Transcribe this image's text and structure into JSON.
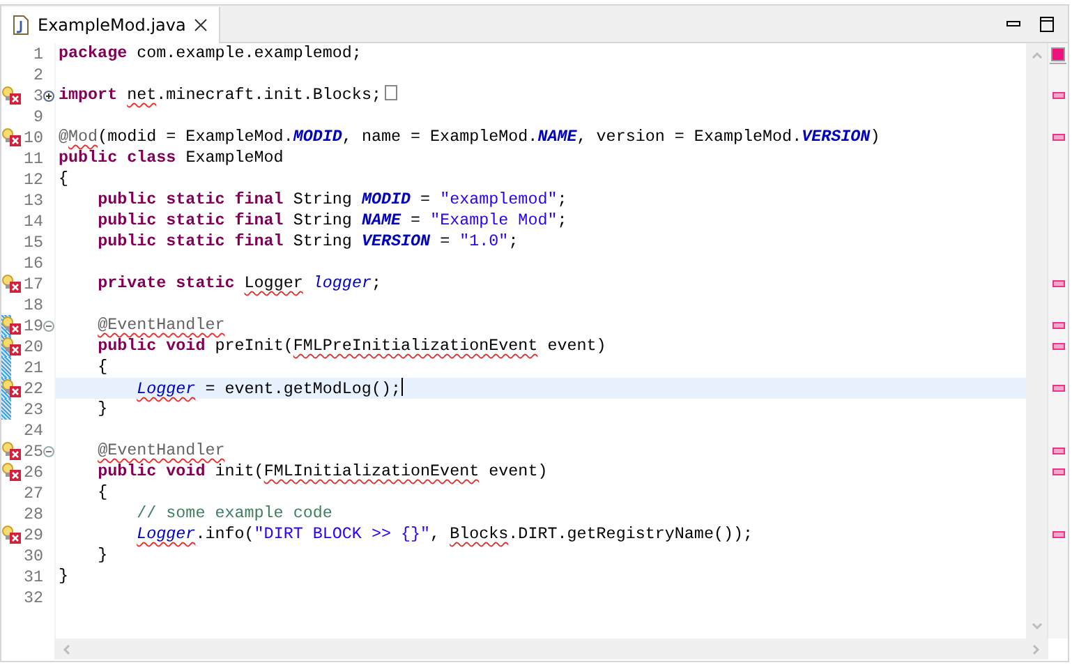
{
  "tab": {
    "title": "ExampleMod.java",
    "selected": true
  },
  "lines": [
    {
      "number": "1",
      "error": false,
      "tokens": [
        {
          "kind": "kw",
          "text": "package"
        },
        {
          "kind": "plain",
          "text": " com.example.examplemod;"
        }
      ]
    },
    {
      "number": "2",
      "error": false
    },
    {
      "number": "3",
      "error": true,
      "collapsed": true,
      "tokens": [
        {
          "kind": "kw",
          "text": "import "
        },
        {
          "kind": "plain",
          "text": "net",
          "error": true
        },
        {
          "kind": "plain",
          "text": ".minecraft.init.Blocks;"
        }
      ]
    },
    {
      "number": "9",
      "error": false
    },
    {
      "number": "10",
      "error": true,
      "tokens": [
        {
          "kind": "annotation",
          "text": "@"
        },
        {
          "kind": "annotation",
          "text": "Mod",
          "error": true
        },
        {
          "kind": "plain",
          "text": "(modid = ExampleMod."
        },
        {
          "kind": "constant",
          "text": "MODID"
        },
        {
          "kind": "plain",
          "text": ", name = ExampleMod."
        },
        {
          "kind": "constant",
          "text": "NAME"
        },
        {
          "kind": "plain",
          "text": ", version = ExampleMod."
        },
        {
          "kind": "constant",
          "text": "VERSION"
        },
        {
          "kind": "plain",
          "text": ")"
        }
      ]
    },
    {
      "number": "11",
      "error": false,
      "tokens": [
        {
          "kind": "kw",
          "text": "public class"
        },
        {
          "kind": "plain",
          "text": " ExampleMod"
        }
      ]
    },
    {
      "number": "12",
      "error": false,
      "tokens": [
        {
          "kind": "plain",
          "text": "{"
        }
      ]
    },
    {
      "number": "13",
      "error": false,
      "tokens": [
        {
          "kind": "kw",
          "text": "    public static final"
        },
        {
          "kind": "plain",
          "text": " String "
        },
        {
          "kind": "constant",
          "text": "MODID"
        },
        {
          "kind": "plain",
          "text": " = "
        },
        {
          "kind": "str",
          "text": "\"examplemod\""
        },
        {
          "kind": "plain",
          "text": ";"
        }
      ]
    },
    {
      "number": "14",
      "error": false,
      "tokens": [
        {
          "kind": "kw",
          "text": "    public static final"
        },
        {
          "kind": "plain",
          "text": " String "
        },
        {
          "kind": "constant",
          "text": "NAME"
        },
        {
          "kind": "plain",
          "text": " = "
        },
        {
          "kind": "str",
          "text": "\"Example Mod\""
        },
        {
          "kind": "plain",
          "text": ";"
        }
      ]
    },
    {
      "number": "15",
      "error": false,
      "tokens": [
        {
          "kind": "kw",
          "text": "    public static final"
        },
        {
          "kind": "plain",
          "text": " String "
        },
        {
          "kind": "constant",
          "text": "VERSION"
        },
        {
          "kind": "plain",
          "text": " = "
        },
        {
          "kind": "str",
          "text": "\"1.0\""
        },
        {
          "kind": "plain",
          "text": ";"
        }
      ]
    },
    {
      "number": "16",
      "error": false
    },
    {
      "number": "17",
      "error": true,
      "tokens": [
        {
          "kind": "kw",
          "text": "    private static "
        },
        {
          "kind": "plain",
          "text": "Logger",
          "error": true
        },
        {
          "kind": "field",
          "text": " logger"
        },
        {
          "kind": "plain",
          "text": ";"
        }
      ]
    },
    {
      "number": "18",
      "error": false
    },
    {
      "number": "19",
      "error": true,
      "changed": true,
      "collapsed": false,
      "tokens": [
        {
          "kind": "annotation",
          "text": "    @EventHandler",
          "error": true
        }
      ]
    },
    {
      "number": "20",
      "error": true,
      "changed": true,
      "tokens": [
        {
          "kind": "kw",
          "text": "    public void"
        },
        {
          "kind": "plain",
          "text": " preInit("
        },
        {
          "kind": "plain",
          "text": "FMLPreInitializationEvent",
          "error": true
        },
        {
          "kind": "plain",
          "text": " event)"
        }
      ]
    },
    {
      "number": "21",
      "error": false,
      "changed": true,
      "tokens": [
        {
          "kind": "plain",
          "text": "    {"
        }
      ]
    },
    {
      "number": "22",
      "error": true,
      "changed": true,
      "current": true,
      "tokens": [
        {
          "kind": "field",
          "text": "        Logger",
          "error": true
        },
        {
          "kind": "plain",
          "text": " = event.getModLog();"
        }
      ]
    },
    {
      "number": "23",
      "error": false,
      "changed": true,
      "tokens": [
        {
          "kind": "plain",
          "text": "    }"
        }
      ]
    },
    {
      "number": "24",
      "error": false
    },
    {
      "number": "25",
      "error": true,
      "collapsed": false,
      "tokens": [
        {
          "kind": "annotation",
          "text": "    @EventHandler",
          "error": true
        }
      ]
    },
    {
      "number": "26",
      "error": true,
      "tokens": [
        {
          "kind": "kw",
          "text": "    public void"
        },
        {
          "kind": "plain",
          "text": " init("
        },
        {
          "kind": "plain",
          "text": "FMLInitializationEvent",
          "error": true
        },
        {
          "kind": "plain",
          "text": " event)"
        }
      ]
    },
    {
      "number": "27",
      "error": false,
      "tokens": [
        {
          "kind": "plain",
          "text": "    {"
        }
      ]
    },
    {
      "number": "28",
      "error": false,
      "tokens": [
        {
          "kind": "comment",
          "text": "        // some example code"
        }
      ]
    },
    {
      "number": "29",
      "error": true,
      "tokens": [
        {
          "kind": "field",
          "text": "        Logger",
          "error": true
        },
        {
          "kind": "plain",
          "text": ".info("
        },
        {
          "kind": "str",
          "text": "\"DIRT BLOCK >> {}\""
        },
        {
          "kind": "plain",
          "text": ", "
        },
        {
          "kind": "plain",
          "text": "Blocks",
          "error": true
        },
        {
          "kind": "plain",
          "text": ".DIRT.getRegistryName());"
        }
      ]
    },
    {
      "number": "30",
      "error": false,
      "tokens": [
        {
          "kind": "plain",
          "text": "    }"
        }
      ]
    },
    {
      "number": "31",
      "error": false,
      "tokens": [
        {
          "kind": "plain",
          "text": "}"
        }
      ]
    },
    {
      "number": "32",
      "error": false
    }
  ]
}
